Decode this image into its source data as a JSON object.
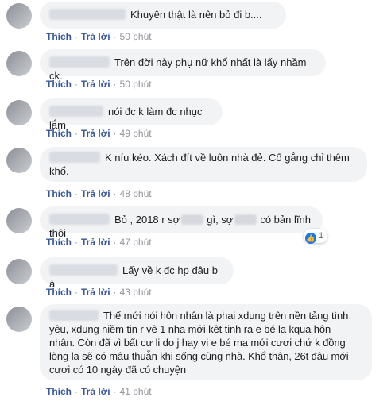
{
  "actions": {
    "like": "Thích",
    "reply": "Trả lời",
    "separator": "·"
  },
  "comments": [
    {
      "text": "Khuyên thật là nên bỏ đi b....",
      "time": "50 phút"
    },
    {
      "text": "Trên đời này phụ nữ khổ nhất là lấy nhầm ck.",
      "time": "50 phút"
    },
    {
      "text": "nói đc k làm đc nhục lắm",
      "time": "49 phút"
    },
    {
      "text_line1": "K níu kéo. Xách đít về luôn nhà đẻ. Cố gắng chỉ thêm",
      "text_line2": "khổ.",
      "time": "48 phút"
    },
    {
      "text_a": "Bỏ , 2018 r sợ",
      "text_b": "gì, sợ",
      "text_c": "có bản lĩnh thôi",
      "time": "47 phút",
      "reaction_count": "1"
    },
    {
      "text": "Lấy về k đc hp đâu b à",
      "time": "43 phút"
    },
    {
      "text_line1": "Thế mới nói hôn nhân là phai xdung trên nền tảng tình",
      "text_line2": "yêu, xdung niềm tin r vê 1 nha mới kêt tinh ra e bé la kqua hôn",
      "text_line3": "nhân. Còn đã vì bất cư li do j hay vi e bé ma mới cươi chứ k đồng",
      "text_line4": "lòng la sẽ có mâu thuẫn khi sống cùng nhà. Khổ thân, 26t đâu mới",
      "text_line5": "cươi có 10 ngày đã có chuyện",
      "time": "41 phút"
    }
  ]
}
